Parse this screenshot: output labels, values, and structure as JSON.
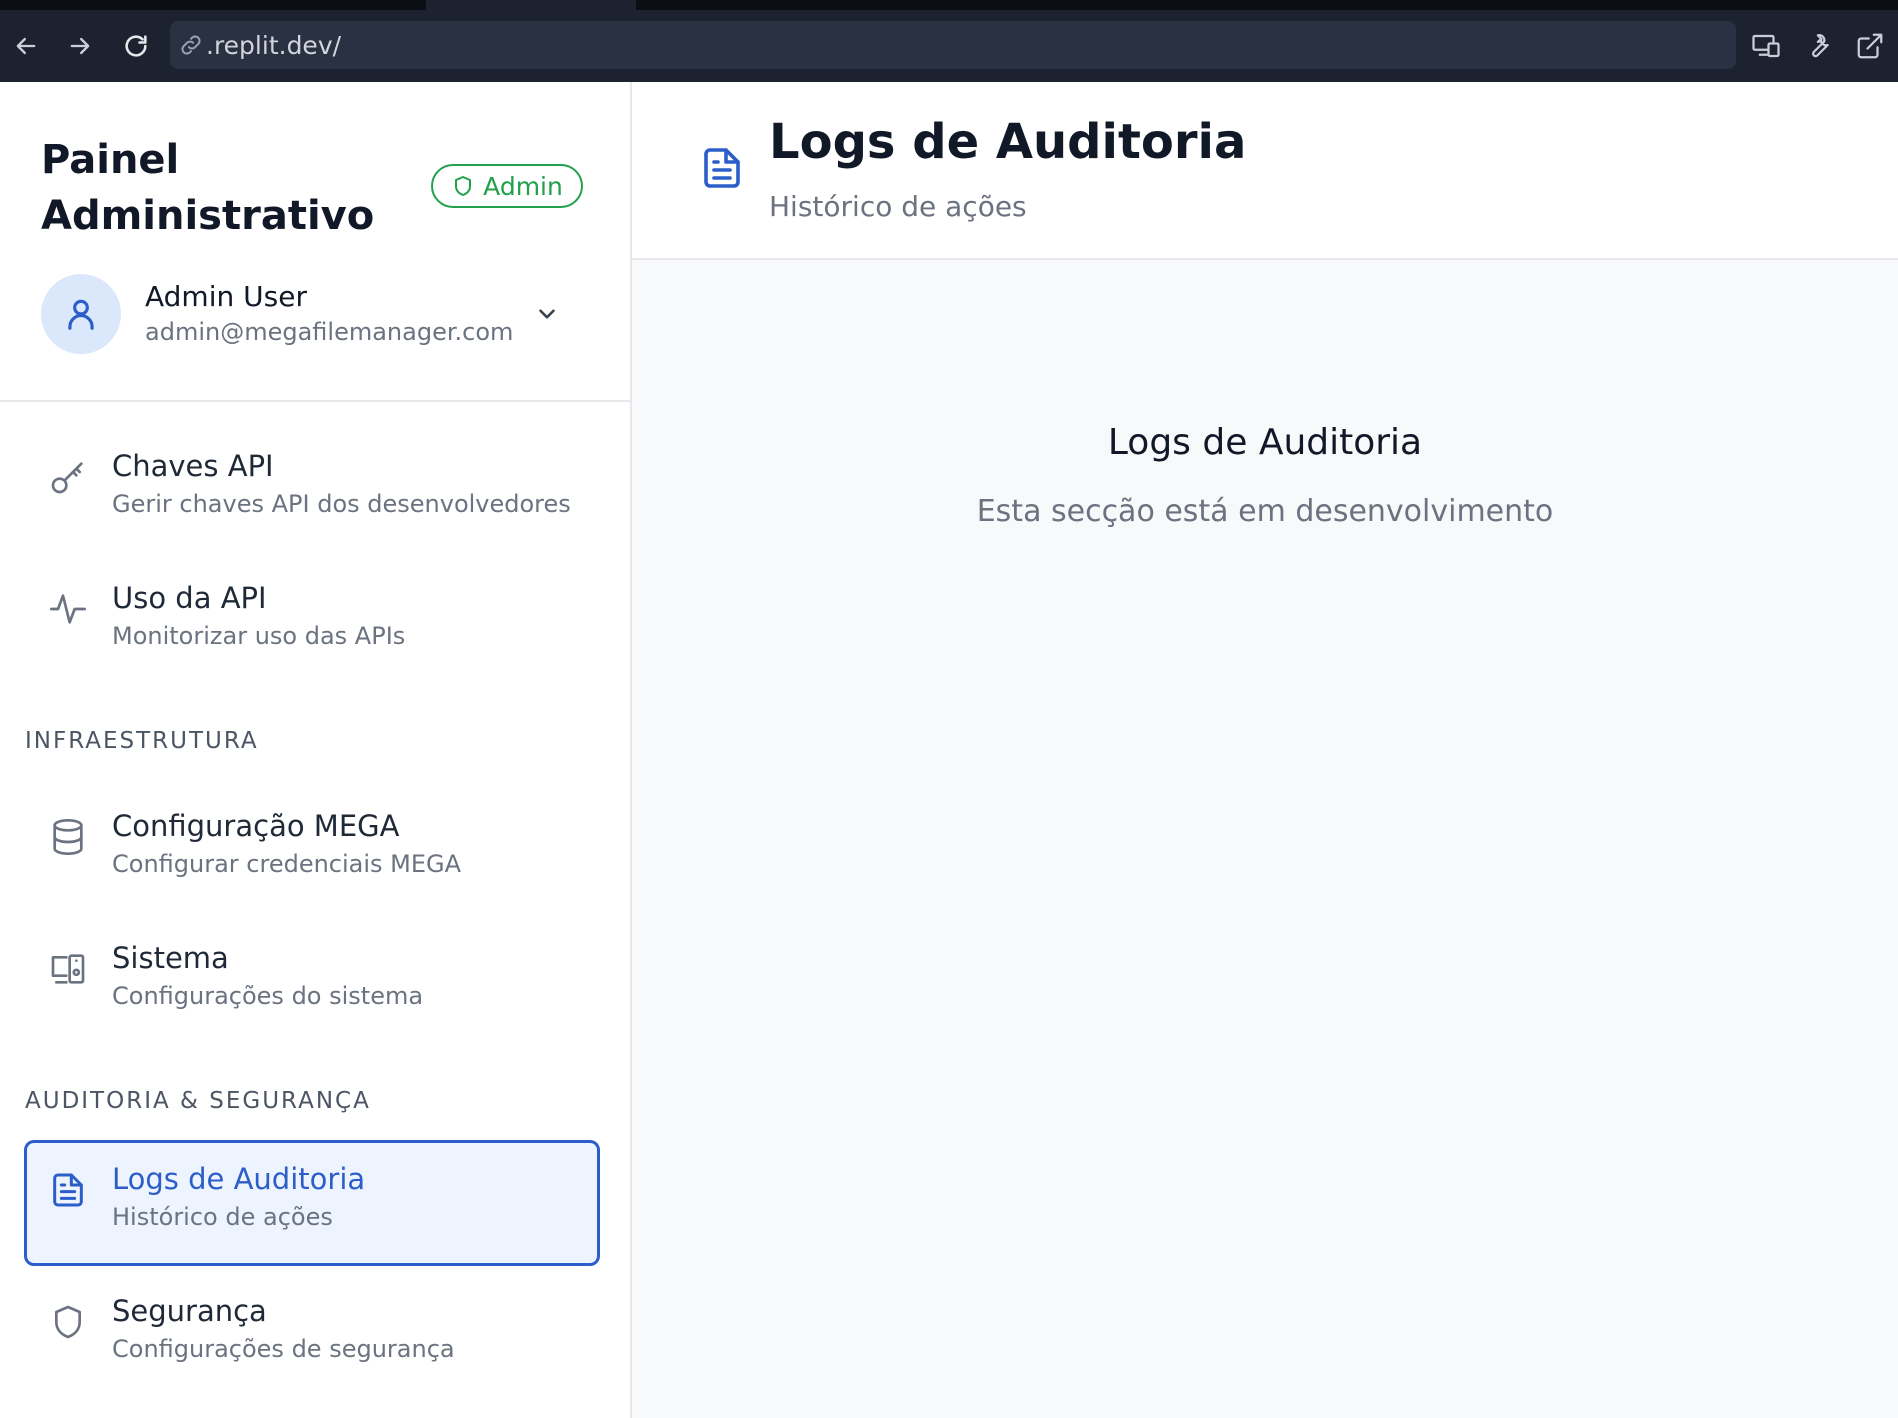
{
  "browser": {
    "url": ".replit.dev/"
  },
  "sidebar": {
    "title": "Painel Administrativo",
    "badge": "Admin",
    "user": {
      "name": "Admin User",
      "email": "admin@megafilemanager.com"
    },
    "items": [
      {
        "id": "chaves-api",
        "icon": "key-icon",
        "title": "Chaves API",
        "subtitle": "Gerir chaves API dos desenvolvedores"
      },
      {
        "id": "uso-api",
        "icon": "activity-icon",
        "title": "Uso da API",
        "subtitle": "Monitorizar uso das APIs"
      },
      {
        "id": "config-mega",
        "icon": "database-icon",
        "title": "Configuração MEGA",
        "subtitle": "Configurar credenciais MEGA"
      },
      {
        "id": "sistema",
        "icon": "devices-icon",
        "title": "Sistema",
        "subtitle": "Configurações do sistema"
      },
      {
        "id": "logs-auditoria",
        "icon": "file-text-icon",
        "title": "Logs de Auditoria",
        "subtitle": "Histórico de ações",
        "active": true
      },
      {
        "id": "seguranca",
        "icon": "shield-icon",
        "title": "Segurança",
        "subtitle": "Configurações de segurança"
      }
    ],
    "sections": {
      "infra": "INFRAESTRUTURA",
      "audit": "AUDITORIA & SEGURANÇA"
    }
  },
  "main": {
    "title": "Logs de Auditoria",
    "subtitle": "Histórico de ações",
    "empty_title": "Logs de Auditoria",
    "empty_message": "Esta secção está em desenvolvimento"
  },
  "colors": {
    "accent": "#2c5ec9",
    "badge_green": "#22a04b",
    "chrome_bg": "#1c2230"
  }
}
